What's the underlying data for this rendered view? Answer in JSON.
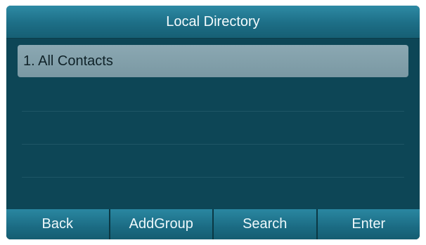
{
  "title": "Local Directory",
  "list": {
    "items": [
      {
        "label": "1. All Contacts",
        "selected": true
      }
    ]
  },
  "softkeys": {
    "back": "Back",
    "addgroup": "AddGroup",
    "search": "Search",
    "enter": "Enter"
  },
  "colors": {
    "background": "#0d4656",
    "titlebar": "#1d6e86",
    "selected_row": "#7f9da8",
    "softkey": "#1b6b83",
    "text": "#f4fbfd"
  }
}
